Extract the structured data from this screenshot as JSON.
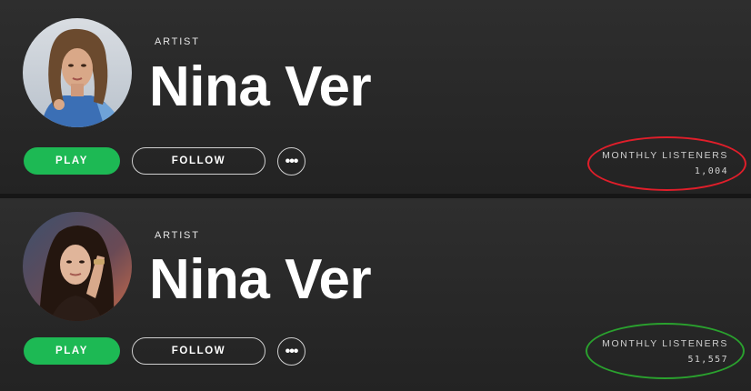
{
  "profiles": [
    {
      "kind": "ARTIST",
      "name": "Nina Ver",
      "play_label": "PLAY",
      "follow_label": "FOLLOW",
      "more_label": "•••",
      "listeners_label": "MONTHLY LISTENERS",
      "listeners_count": "1,004",
      "highlight_color": "#e01e2a"
    },
    {
      "kind": "ARTIST",
      "name": "Nina Ver",
      "play_label": "PLAY",
      "follow_label": "FOLLOW",
      "more_label": "•••",
      "listeners_label": "MONTHLY LISTENERS",
      "listeners_count": "51,557",
      "highlight_color": "#2aa12e"
    }
  ],
  "colors": {
    "play_button": "#1db954",
    "background": "#2a2a2a"
  },
  "icons": [
    "artist-avatar",
    "more-options-icon"
  ]
}
